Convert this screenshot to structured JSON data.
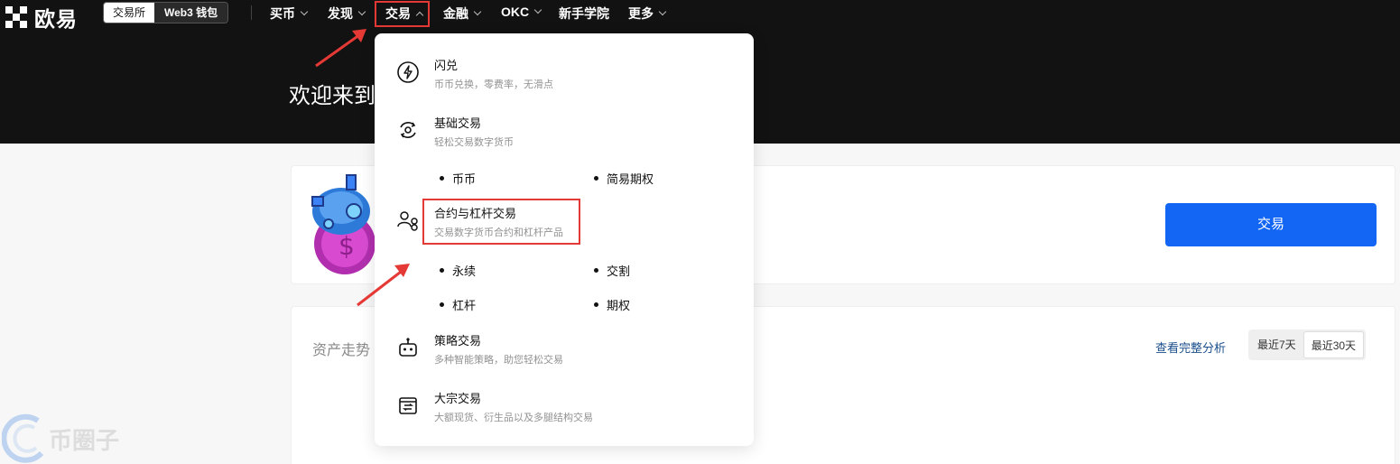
{
  "logo": {
    "text": "欧易"
  },
  "mode_switch": {
    "exchange": "交易所",
    "wallet": "Web3 钱包"
  },
  "nav": {
    "items": [
      {
        "label": "买币"
      },
      {
        "label": "发现"
      },
      {
        "label": "交易"
      },
      {
        "label": "金融"
      },
      {
        "label": "OKC"
      },
      {
        "label": "新手学院"
      },
      {
        "label": "更多"
      }
    ]
  },
  "hero": {
    "welcome": "欢迎来到"
  },
  "card": {
    "trade_button": "交易"
  },
  "assets": {
    "title": "资产走势",
    "analysis_link": "查看完整分析",
    "range_7d": "最近7天",
    "range_30d": "最近30天"
  },
  "dropdown": {
    "flash": {
      "title": "闪兑",
      "subtitle": "币币兑换，零费率，无滑点"
    },
    "basic": {
      "title": "基础交易",
      "subtitle": "轻松交易数字货币"
    },
    "basic_links": {
      "spot": "币币",
      "easy_options": "简易期权"
    },
    "derivatives": {
      "title": "合约与杠杆交易",
      "subtitle": "交易数字货币合约和杠杆产品"
    },
    "deriv_links": {
      "perpetual": "永续",
      "delivery": "交割",
      "margin": "杠杆",
      "options": "期权"
    },
    "strategy": {
      "title": "策略交易",
      "subtitle": "多种智能策略，助您轻松交易"
    },
    "block": {
      "title": "大宗交易",
      "subtitle": "大额现货、衍生品以及多腿结构交易"
    }
  },
  "watermark": {
    "text": "币圈子"
  },
  "colors": {
    "primary": "#1366f4",
    "highlight": "#e53935",
    "dark": "#121212"
  }
}
